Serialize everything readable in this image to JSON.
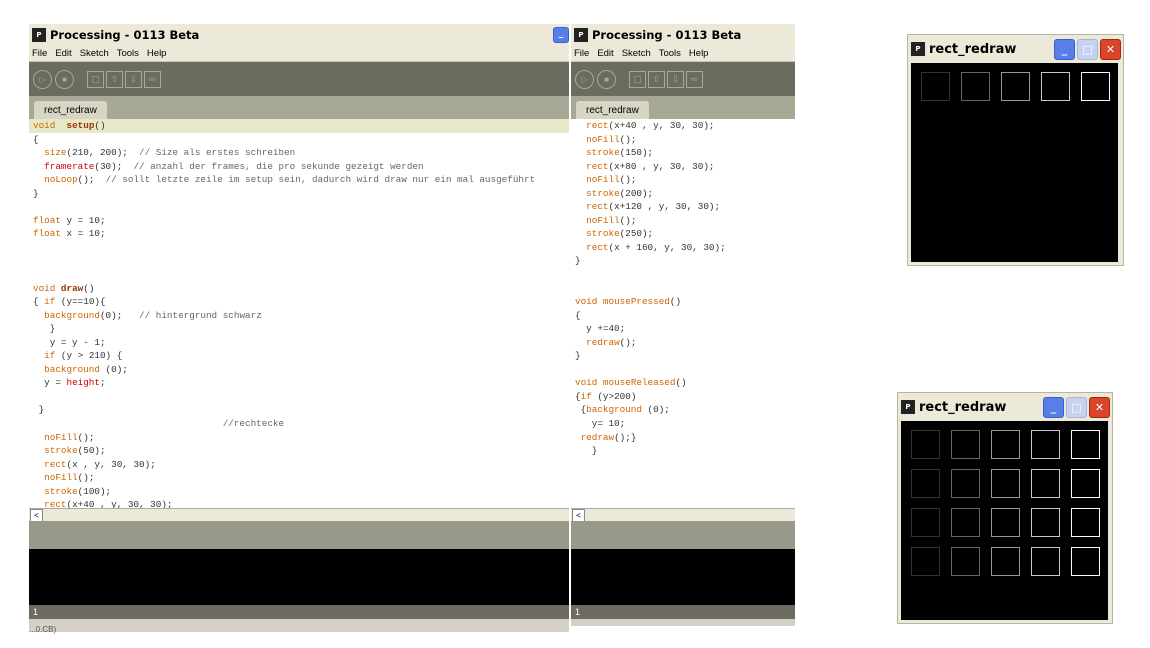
{
  "left_window": {
    "title": "Processing - 0113 Beta",
    "icon": "p5-icon",
    "menu": [
      "File",
      "Edit",
      "Sketch",
      "Tools",
      "Help"
    ],
    "tab": "rect_redraw",
    "status_line": "1",
    "bottom_text": "...0.CB)",
    "code": [
      {
        "tokens": [
          [
            "k1",
            "void"
          ],
          [
            "",
            "  "
          ],
          [
            "k2",
            "setup"
          ],
          [
            "",
            "()"
          ]
        ]
      },
      {
        "tokens": [
          [
            "",
            "{"
          ]
        ]
      },
      {
        "tokens": [
          [
            "",
            "  "
          ],
          [
            "k1",
            "size"
          ],
          [
            "",
            "(210, 200);  "
          ],
          [
            "cmt",
            "// Size als erstes schreiben"
          ]
        ]
      },
      {
        "tokens": [
          [
            "",
            "  "
          ],
          [
            "k3",
            "framerate"
          ],
          [
            "",
            "(30);  "
          ],
          [
            "cmt",
            "// anzahl der frames, die pro sekunde gezeigt werden"
          ]
        ]
      },
      {
        "tokens": [
          [
            "",
            "  "
          ],
          [
            "k1",
            "noLoop"
          ],
          [
            "",
            "();  "
          ],
          [
            "cmt",
            "// sollt letzte zeile im setup sein, dadurch wird draw nur ein mal ausgeführt"
          ]
        ]
      },
      {
        "tokens": [
          [
            "",
            "}"
          ]
        ]
      },
      {
        "tokens": [
          [
            "",
            ""
          ]
        ]
      },
      {
        "tokens": [
          [
            "k1",
            "float"
          ],
          [
            "",
            " y = 10;"
          ]
        ]
      },
      {
        "tokens": [
          [
            "k1",
            "float"
          ],
          [
            "",
            " x = 10;"
          ]
        ]
      },
      {
        "tokens": [
          [
            "",
            ""
          ]
        ]
      },
      {
        "tokens": [
          [
            "",
            ""
          ]
        ]
      },
      {
        "tokens": [
          [
            "",
            ""
          ]
        ]
      },
      {
        "tokens": [
          [
            "k1",
            "void"
          ],
          [
            "",
            " "
          ],
          [
            "k2",
            "draw"
          ],
          [
            "",
            "()"
          ]
        ]
      },
      {
        "tokens": [
          [
            "",
            "{ "
          ],
          [
            "k1",
            "if"
          ],
          [
            "",
            " (y==10){"
          ]
        ]
      },
      {
        "tokens": [
          [
            "",
            "  "
          ],
          [
            "k1",
            "background"
          ],
          [
            "",
            "(0);   "
          ],
          [
            "cmt",
            "// hintergrund schwarz"
          ]
        ]
      },
      {
        "tokens": [
          [
            "",
            "   }"
          ]
        ]
      },
      {
        "tokens": [
          [
            "",
            "   y = y - 1;"
          ]
        ]
      },
      {
        "tokens": [
          [
            "",
            "  "
          ],
          [
            "k1",
            "if"
          ],
          [
            "",
            " (y > 210) {"
          ]
        ]
      },
      {
        "tokens": [
          [
            "",
            "  "
          ],
          [
            "k1",
            "background"
          ],
          [
            "",
            " (0);"
          ]
        ]
      },
      {
        "tokens": [
          [
            "",
            "  y = "
          ],
          [
            "k3",
            "height"
          ],
          [
            "",
            ";"
          ]
        ]
      },
      {
        "tokens": [
          [
            "",
            ""
          ]
        ]
      },
      {
        "tokens": [
          [
            "",
            " }"
          ]
        ]
      },
      {
        "tokens": [
          [
            "",
            "                                  "
          ],
          [
            "cmt",
            "//rechtecke"
          ]
        ]
      },
      {
        "tokens": [
          [
            "",
            "  "
          ],
          [
            "k1",
            "noFill"
          ],
          [
            "",
            "();"
          ]
        ]
      },
      {
        "tokens": [
          [
            "",
            "  "
          ],
          [
            "k1",
            "stroke"
          ],
          [
            "",
            "(50);"
          ]
        ]
      },
      {
        "tokens": [
          [
            "",
            "  "
          ],
          [
            "k1",
            "rect"
          ],
          [
            "",
            "(x , y, 30, 30);"
          ]
        ]
      },
      {
        "tokens": [
          [
            "",
            "  "
          ],
          [
            "k1",
            "noFill"
          ],
          [
            "",
            "();"
          ]
        ]
      },
      {
        "tokens": [
          [
            "",
            "  "
          ],
          [
            "k1",
            "stroke"
          ],
          [
            "",
            "(100);"
          ]
        ]
      },
      {
        "tokens": [
          [
            "",
            "  "
          ],
          [
            "k1",
            "rect"
          ],
          [
            "",
            "(x+40 , y, 30, 30);"
          ]
        ]
      }
    ]
  },
  "right_window": {
    "title": "Processing - 0113 Beta",
    "icon": "p5-icon",
    "menu": [
      "File",
      "Edit",
      "Sketch",
      "Tools",
      "Help"
    ],
    "tab": "rect_redraw",
    "status_line": "1",
    "code": [
      {
        "tokens": [
          [
            "",
            "  "
          ],
          [
            "k1",
            "rect"
          ],
          [
            "",
            "(x+40 , y, 30, 30);"
          ]
        ]
      },
      {
        "tokens": [
          [
            "",
            "  "
          ],
          [
            "k1",
            "noFill"
          ],
          [
            "",
            "();"
          ]
        ]
      },
      {
        "tokens": [
          [
            "",
            "  "
          ],
          [
            "k1",
            "stroke"
          ],
          [
            "",
            "(150);"
          ]
        ]
      },
      {
        "tokens": [
          [
            "",
            "  "
          ],
          [
            "k1",
            "rect"
          ],
          [
            "",
            "(x+80 , y, 30, 30);"
          ]
        ]
      },
      {
        "tokens": [
          [
            "",
            "  "
          ],
          [
            "k1",
            "noFill"
          ],
          [
            "",
            "();"
          ]
        ]
      },
      {
        "tokens": [
          [
            "",
            "  "
          ],
          [
            "k1",
            "stroke"
          ],
          [
            "",
            "(200);"
          ]
        ]
      },
      {
        "tokens": [
          [
            "",
            "  "
          ],
          [
            "k1",
            "rect"
          ],
          [
            "",
            "(x+120 , y, 30, 30);"
          ]
        ]
      },
      {
        "tokens": [
          [
            "",
            "  "
          ],
          [
            "k1",
            "noFill"
          ],
          [
            "",
            "();"
          ]
        ]
      },
      {
        "tokens": [
          [
            "",
            "  "
          ],
          [
            "k1",
            "stroke"
          ],
          [
            "",
            "(250);"
          ]
        ]
      },
      {
        "tokens": [
          [
            "",
            "  "
          ],
          [
            "k1",
            "rect"
          ],
          [
            "",
            "(x + 160, y, 30, 30);"
          ]
        ]
      },
      {
        "tokens": [
          [
            "",
            "}"
          ]
        ]
      },
      {
        "tokens": [
          [
            "",
            ""
          ]
        ]
      },
      {
        "tokens": [
          [
            "",
            ""
          ]
        ]
      },
      {
        "tokens": [
          [
            "k1",
            "void"
          ],
          [
            "",
            " "
          ],
          [
            "k1",
            "mousePressed"
          ],
          [
            "",
            "()"
          ]
        ]
      },
      {
        "tokens": [
          [
            "",
            "{"
          ]
        ]
      },
      {
        "tokens": [
          [
            "",
            "  y +=40;"
          ]
        ]
      },
      {
        "tokens": [
          [
            "",
            "  "
          ],
          [
            "k1",
            "redraw"
          ],
          [
            "",
            "();"
          ]
        ]
      },
      {
        "tokens": [
          [
            "",
            "}"
          ]
        ]
      },
      {
        "tokens": [
          [
            "",
            ""
          ]
        ]
      },
      {
        "tokens": [
          [
            "k1",
            "void"
          ],
          [
            "",
            " "
          ],
          [
            "k1",
            "mouseReleased"
          ],
          [
            "",
            "()"
          ]
        ]
      },
      {
        "tokens": [
          [
            "",
            "{"
          ],
          [
            "k1",
            "if"
          ],
          [
            "",
            " (y>200)"
          ]
        ]
      },
      {
        "tokens": [
          [
            "",
            " {"
          ],
          [
            "k1",
            "background"
          ],
          [
            "",
            " (0);"
          ]
        ]
      },
      {
        "tokens": [
          [
            "",
            "   y= 10;"
          ]
        ]
      },
      {
        "tokens": [
          [
            "",
            " "
          ],
          [
            "k1",
            "redraw"
          ],
          [
            "",
            "();}"
          ]
        ]
      },
      {
        "tokens": [
          [
            "",
            "   }"
          ]
        ]
      }
    ]
  },
  "sketch_window_1": {
    "title": "rect_redraw",
    "icon": "p5-icon",
    "rows": 1,
    "columns": 5,
    "strokes": [
      50,
      100,
      150,
      200,
      250
    ]
  },
  "sketch_window_2": {
    "title": "rect_redraw",
    "icon": "p5-icon",
    "rows": 4,
    "columns": 5,
    "strokes": [
      50,
      100,
      150,
      200,
      250
    ]
  }
}
